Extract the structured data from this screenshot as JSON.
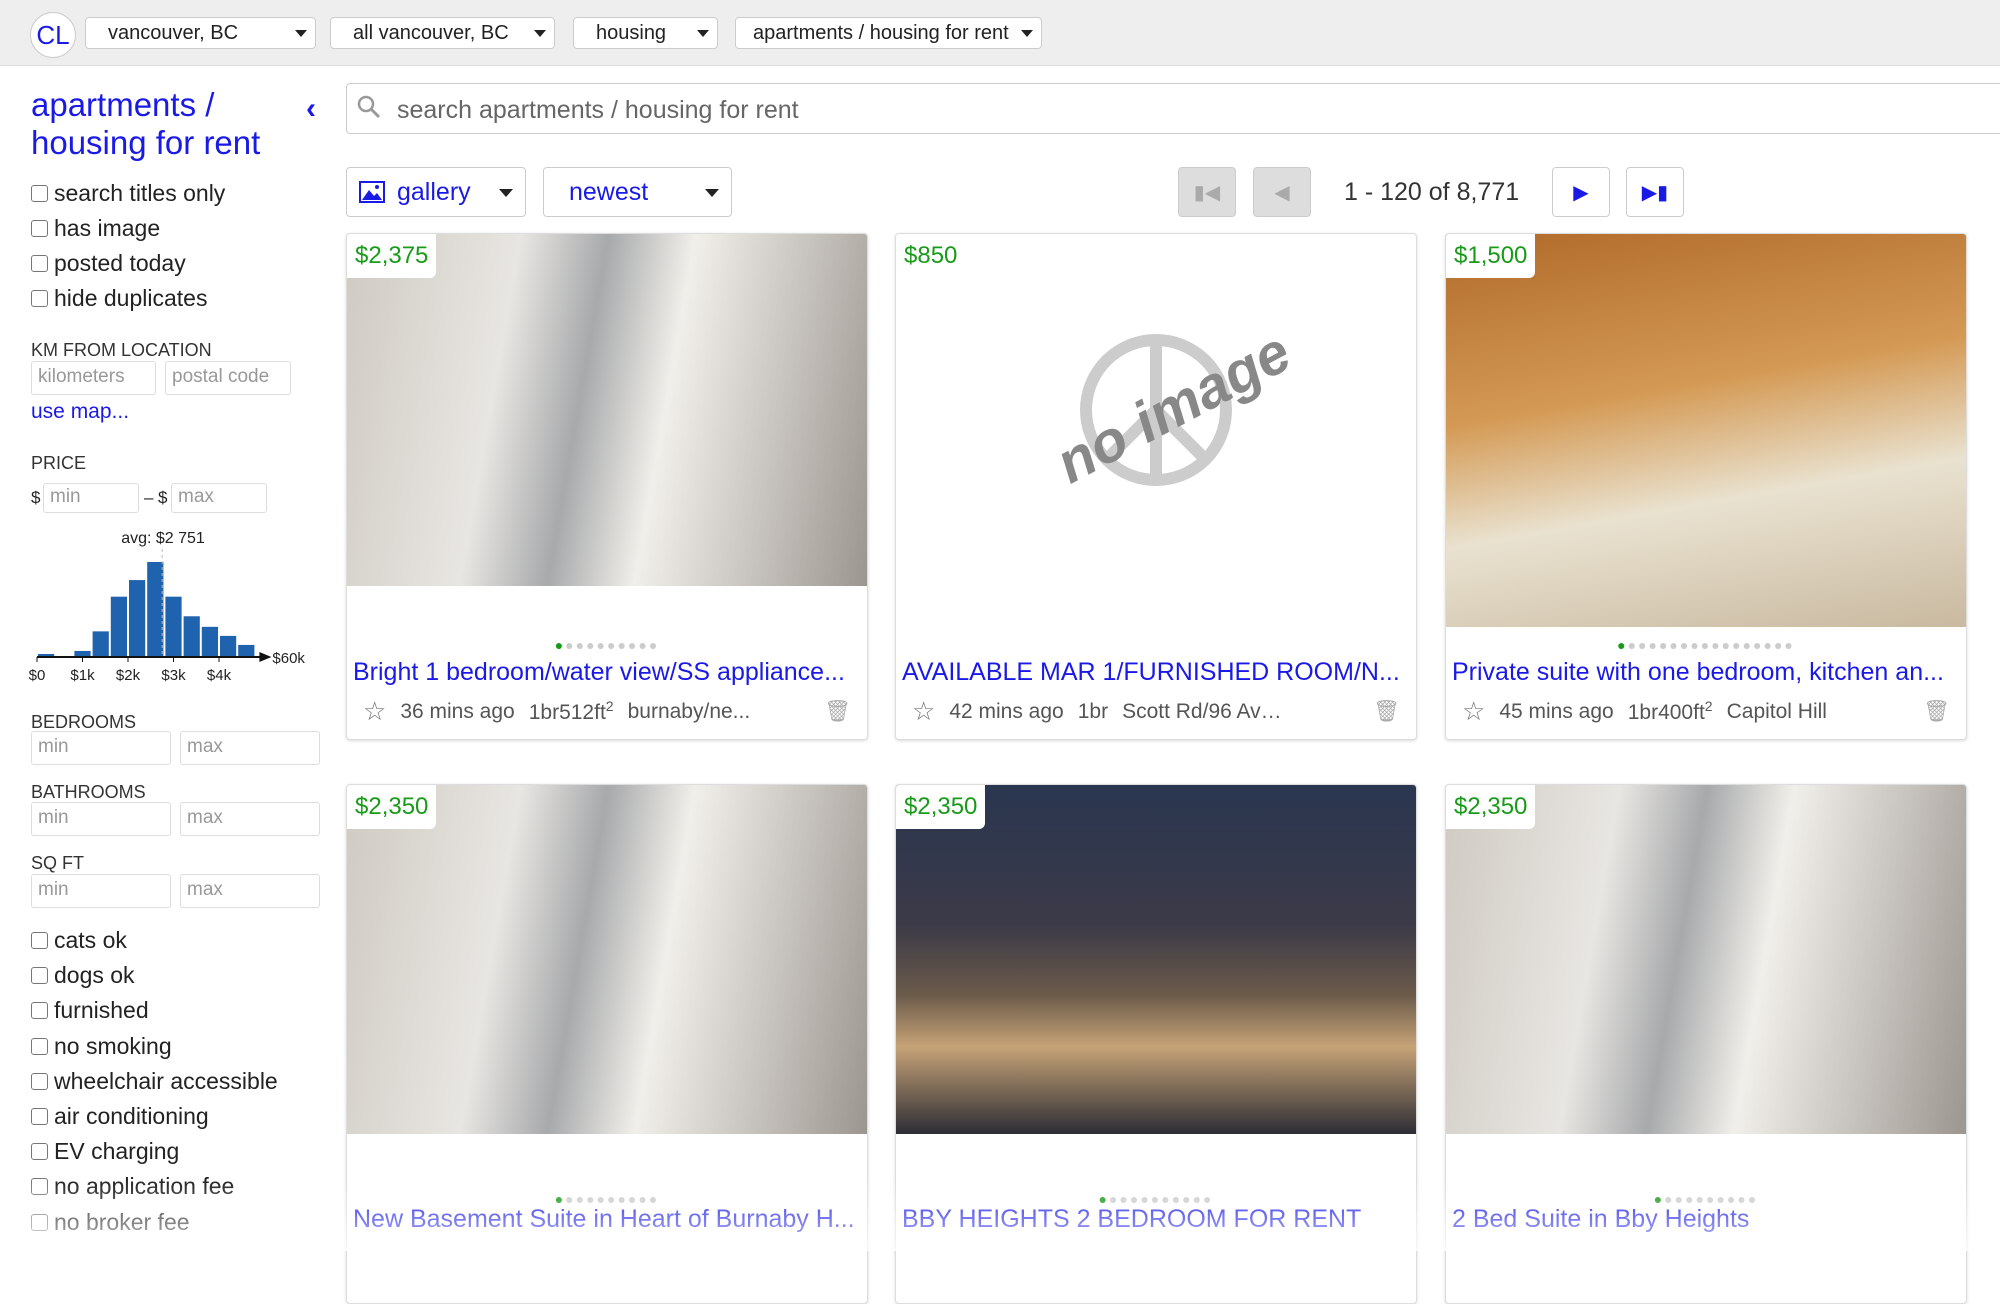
{
  "header": {
    "logo": "CL",
    "dropdowns": [
      "vancouver, BC",
      "all vancouver, BC",
      "housing",
      "apartments / housing for rent"
    ]
  },
  "sidebar": {
    "title": "apartments / housing for rent",
    "top_filters": [
      "search titles only",
      "has image",
      "posted today",
      "hide duplicates"
    ],
    "km_label": "KM FROM LOCATION",
    "km_placeholder": "kilometers",
    "postal_placeholder": "postal code",
    "use_map": "use map...",
    "price_label": "PRICE",
    "currency": "$",
    "dash": "–",
    "min": "min",
    "max": "max",
    "bedrooms_label": "BEDROOMS",
    "bathrooms_label": "BATHROOMS",
    "sqft_label": "SQ FT",
    "amenities": [
      "cats ok",
      "dogs ok",
      "furnished",
      "no smoking",
      "wheelchair accessible",
      "air conditioning",
      "EV charging",
      "no application fee",
      "no broker fee"
    ]
  },
  "chart_data": {
    "type": "bar",
    "title": "avg: $2 751",
    "average": 2751,
    "bin_starts": [
      0,
      400,
      800,
      1200,
      1600,
      2000,
      2400,
      2800,
      3200,
      3600,
      4000,
      4400
    ],
    "values": [
      2,
      0.5,
      4,
      17,
      40,
      51,
      63,
      40,
      27,
      20,
      14,
      8
    ],
    "xticks": [
      "$0",
      "$1k",
      "$2k",
      "$3k",
      "$4k"
    ],
    "x_max_label": "$60k",
    "color": "#1f62ad"
  },
  "search": {
    "placeholder": "search apartments / housing for rent"
  },
  "toolbar": {
    "view": "gallery",
    "sort": "newest",
    "range": "1 - 120 of 8,771"
  },
  "listings": [
    {
      "price": "$2,375",
      "title": "Bright 1 bedroom/water view/SS appliance...",
      "time": "36 mins ago",
      "br": "1br",
      "sqft": "512ft",
      "loc": "burnaby/ne...",
      "dots": 10,
      "img": "kitchen"
    },
    {
      "price": "$850",
      "title": "AVAILABLE MAR 1/FURNISHED ROOM/N...",
      "time": "42 mins ago",
      "br": "1br",
      "sqft": "",
      "loc": "Scott Rd/96 Ave S...",
      "dots": 0,
      "img": "none",
      "no_image": "no image"
    },
    {
      "price": "$1,500",
      "title": "Private suite with one bedroom, kitchen an...",
      "time": "45 mins ago",
      "br": "1br",
      "sqft": "400ft",
      "loc": "Capitol Hill",
      "dots": 17,
      "img": "wood"
    },
    {
      "price": "$2,350",
      "title": "New Basement Suite in Heart of Burnaby H...",
      "dots": 10,
      "img": "kitchen"
    },
    {
      "price": "$2,350",
      "title": "BBY HEIGHTS 2 BEDROOM FOR RENT",
      "dots": 11,
      "img": "night"
    },
    {
      "price": "$2,350",
      "title": "2 Bed Suite in Bby Heights",
      "dots": 10,
      "img": "kitchen"
    }
  ]
}
